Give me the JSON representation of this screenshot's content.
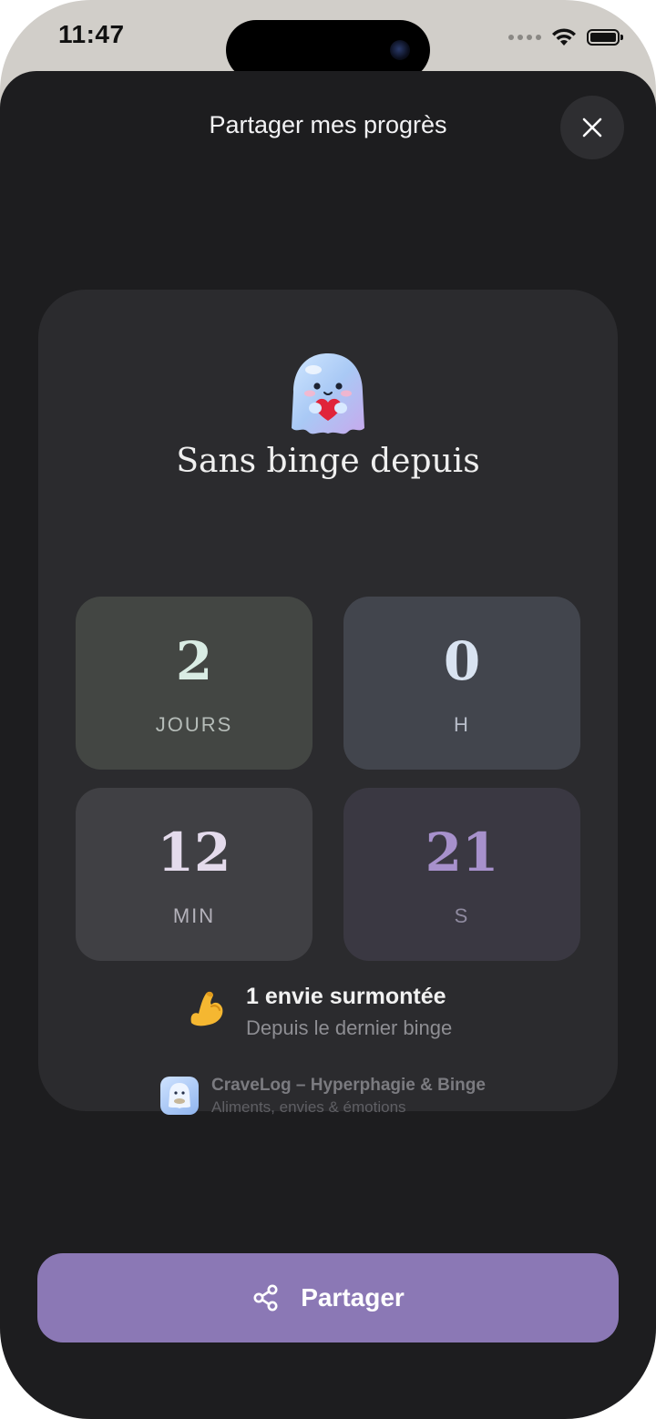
{
  "status_bar": {
    "time": "11:47"
  },
  "sheet": {
    "title": "Partager mes progrès",
    "close_icon": "close-icon"
  },
  "card": {
    "mascot_icon": "ghost-heart-mascot-icon",
    "headline": "Sans binge depuis",
    "tiles": [
      {
        "value": "2",
        "unit": "JOURS"
      },
      {
        "value": "0",
        "unit": "H"
      },
      {
        "value": "12",
        "unit": "MIN"
      },
      {
        "value": "21",
        "unit": "S"
      }
    ],
    "stat": {
      "emoji_icon": "flexed-biceps-icon",
      "title": "1 envie surmontée",
      "subtitle": "Depuis le dernier binge"
    },
    "branding": {
      "app_name": "CraveLog – Hyperphagie & Binge",
      "tagline": "Aliments, envies & émotions"
    }
  },
  "share_button": {
    "label": "Partager",
    "icon": "share-icon"
  },
  "colors": {
    "sheet_bg": "#1d1d1f",
    "card_bg": "#2b2b2e",
    "accent": "#8b78b5"
  }
}
